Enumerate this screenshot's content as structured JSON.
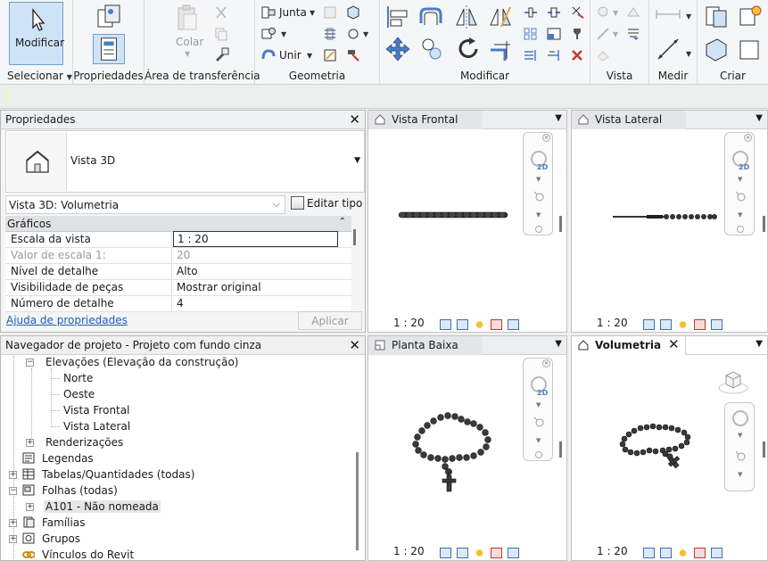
{
  "ribbon": {
    "modify_label": "Modificar",
    "panels": {
      "select": "Selecionar",
      "properties": "Propriedades",
      "clipboard": "Área de transferência",
      "geometry": "Geometria",
      "modify": "Modificar",
      "view": "Vista",
      "measure": "Medir",
      "create": "Criar"
    },
    "paste_label": "Colar",
    "join_label": "Junta",
    "unite_label": "Unir"
  },
  "properties": {
    "title": "Propriedades",
    "type_name": "Vista 3D",
    "instance_selector": "Vista 3D: Volumetria",
    "edit_type_label": "Editar tipo",
    "group": "Gráficos",
    "rows": [
      {
        "key": "Escala da vista",
        "value": "1 : 20"
      },
      {
        "key": "Valor de escala    1:",
        "value": "20"
      },
      {
        "key": "Nível de detalhe",
        "value": "Alto"
      },
      {
        "key": "Visibilidade de peças",
        "value": "Mostrar original"
      },
      {
        "key": "Número de detalhe",
        "value": "4"
      }
    ],
    "help_link": "Ajuda de propriedades",
    "apply_label": "Aplicar"
  },
  "browser": {
    "title": "Navegador de projeto - Projeto com fundo cinza",
    "items": [
      {
        "label": "Elevações (Elevação da construção)"
      },
      {
        "label": "Norte"
      },
      {
        "label": "Oeste"
      },
      {
        "label": "Vista Frontal"
      },
      {
        "label": "Vista Lateral"
      },
      {
        "label": "Renderizações"
      },
      {
        "label": "Legendas"
      },
      {
        "label": "Tabelas/Quantidades (todas)"
      },
      {
        "label": "Folhas (todas)"
      },
      {
        "label": "A101 - Não nomeada"
      },
      {
        "label": "Famílias"
      },
      {
        "label": "Grupos"
      },
      {
        "label": "Vínculos do Revit"
      }
    ]
  },
  "views": {
    "front": {
      "title": "Vista Frontal",
      "scale": "1 : 20"
    },
    "side": {
      "title": "Vista Lateral",
      "scale": "1 : 20"
    },
    "plan": {
      "title": "Planta Baixa",
      "scale": "1 : 20"
    },
    "volumetria": {
      "title": "Volumetria",
      "scale": "1 : 20"
    }
  },
  "icons": {
    "accent": "#4b7cc7",
    "active_button_fill": "#cfe3f7"
  }
}
